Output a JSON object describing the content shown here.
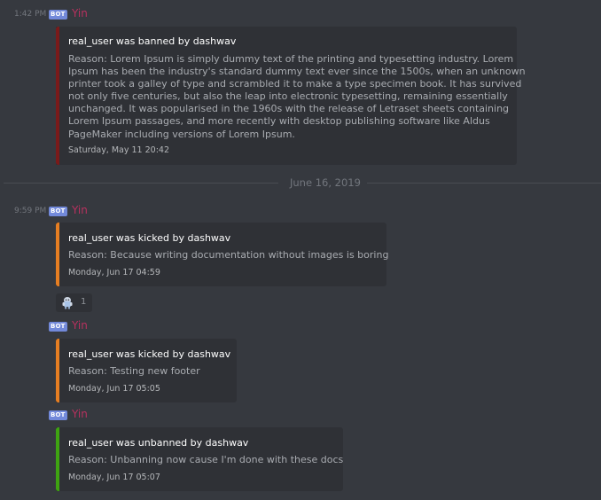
{
  "colors": {
    "background": "#36393f",
    "embed_background": "#2f3136",
    "author": "#b8315f",
    "bot_tag": "#7289da",
    "ban": "#7a1a1a",
    "kick": "#e67e22",
    "unban": "#3ea311"
  },
  "messages": [
    {
      "timestamp": "1:42 PM",
      "bot_tag": "BOT",
      "author": "Yin",
      "embed": {
        "accent": "ban",
        "title": "real_user was banned by dashwav",
        "description_lines": [
          "Reason: Lorem Ipsum is simply dummy text of the printing and typesetting industry. Lorem",
          "Ipsum has been the industry's standard dummy text ever since the 1500s, when an unknown",
          "printer took a galley of type and scrambled it to make a type specimen book. It has survived",
          "not only five centuries, but also the leap into electronic typesetting, remaining essentially",
          "unchanged. It was popularised in the 1960s with the release of Letraset sheets containing",
          "Lorem Ipsum passages, and more recently with desktop publishing software like Aldus",
          "PageMaker including versions of Lorem Ipsum."
        ],
        "footer": "Saturday, May 11 20:42"
      }
    }
  ],
  "date_divider": "June 16, 2019",
  "messages_after": [
    {
      "timestamp": "9:59 PM",
      "bot_tag": "BOT",
      "author": "Yin",
      "embed": {
        "accent": "kick",
        "title": "real_user was kicked by dashwav",
        "description": "Reason: Because writing documentation without images is boring",
        "footer": "Monday, Jun 17 04:59"
      },
      "reaction": {
        "icon": "emoji-icon",
        "count": "1"
      }
    },
    {
      "bot_tag": "BOT",
      "author": "Yin",
      "embed": {
        "accent": "kick",
        "title": "real_user was kicked by dashwav",
        "description": "Reason: Testing new footer",
        "footer": "Monday, Jun 17 05:05"
      }
    },
    {
      "bot_tag": "BOT",
      "author": "Yin",
      "embed": {
        "accent": "unban",
        "title": "real_user was unbanned by dashwav",
        "description": "Reason: Unbanning now cause I'm done with these docs",
        "footer": "Monday, Jun 17 05:07"
      }
    }
  ]
}
